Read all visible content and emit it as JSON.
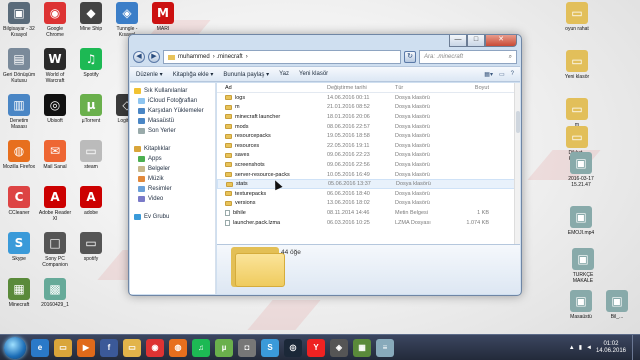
{
  "desktop": {
    "icons": [
      {
        "label": "Bilgisayar - 32 Kısayol",
        "color": "#5a6b7a",
        "glyph": "▣"
      },
      {
        "label": "Google Chrome",
        "color": "#d33",
        "glyph": "◉"
      },
      {
        "label": "Mine Ship",
        "color": "#444",
        "glyph": "◆"
      },
      {
        "label": "Tunngle - Kısayol",
        "color": "#3b7ec8",
        "glyph": "◈"
      },
      {
        "label": "MARI",
        "color": "#c11",
        "glyph": "M"
      },
      {
        "label": "Geri Dönüşüm Kutusu",
        "color": "#7a8a9a",
        "glyph": "▤"
      },
      {
        "label": "World of Warcraft",
        "color": "#2a2a2a",
        "glyph": "W"
      },
      {
        "label": "Spotify",
        "color": "#1db954",
        "glyph": "♫"
      },
      {
        "label": "Denetim Masası",
        "color": "#4a86c5",
        "glyph": "▥"
      },
      {
        "label": "Ubisoft",
        "color": "#111",
        "glyph": "◎"
      },
      {
        "label": "µTorrent",
        "color": "#6ab04c",
        "glyph": "µ"
      },
      {
        "label": "Logitech",
        "color": "#3a3a3a",
        "glyph": "◇"
      },
      {
        "label": "Mozilla Firefox",
        "color": "#e76f1e",
        "glyph": "◍"
      },
      {
        "label": "Mail Sanal",
        "color": "#e63",
        "glyph": "✉"
      },
      {
        "label": "steam",
        "color": "#bbb",
        "glyph": "▭"
      },
      {
        "label": "CCleaner",
        "color": "#d44",
        "glyph": "C"
      },
      {
        "label": "Adobe Reader XI",
        "color": "#c00",
        "glyph": "A"
      },
      {
        "label": "adobe",
        "color": "#c00",
        "glyph": "A"
      },
      {
        "label": "Skype",
        "color": "#3a9ad9",
        "glyph": "S"
      },
      {
        "label": "Sony PC Companion",
        "color": "#555",
        "glyph": "□"
      },
      {
        "label": "spotify",
        "color": "#555",
        "glyph": "▭"
      },
      {
        "label": "Minecraft",
        "color": "#5a8a3a",
        "glyph": "▦"
      },
      {
        "label": "20160429_1",
        "color": "#6a9",
        "glyph": "▩"
      }
    ],
    "right_icons": [
      "oyun rahat",
      "Yeni klasör",
      "m",
      "Dikkat - Kısayol",
      "2016-03-17 15.21.47",
      "EMOJI.mp4",
      "TÜRKÇE MAKALE",
      "Masaüstü",
      "Bil_..."
    ]
  },
  "window": {
    "address": {
      "parts": [
        "muhammed",
        "› .minecraft",
        "›"
      ],
      "search_placeholder": "Ara: .minecraft"
    },
    "controls": {
      "minimize": "—",
      "maximize": "□",
      "close": "✕"
    },
    "toolbar": {
      "items": [
        "Düzenle ▾",
        "Kitaplığa ekle ▾",
        "Bununla paylaş ▾",
        "Yaz",
        "Yeni klasör"
      ]
    },
    "nav": {
      "favorites_title": "Sık Kullanılanlar",
      "favorites": [
        "iCloud Fotoğrafları",
        "Karşıdan Yüklemeler",
        "Masaüstü",
        "Son Yerler"
      ],
      "libraries_title": "Kitaplıklar",
      "libraries": [
        "Apps",
        "Belgeler",
        "Müzik",
        "Resimler",
        "Video"
      ],
      "homegroup": "Ev Grubu"
    },
    "columns": [
      "Ad",
      "Değiştirme tarihi",
      "Tür",
      "Boyut"
    ],
    "files": [
      {
        "name": "logs",
        "date": "14.06.2016 00:11",
        "type": "Dosya klasörü",
        "size": "",
        "kind": "folder"
      },
      {
        "name": "m",
        "date": "21.01.2016 08:52",
        "type": "Dosya klasörü",
        "size": "",
        "kind": "folder"
      },
      {
        "name": "minecraft launcher",
        "date": "18.01.2016 20:06",
        "type": "Dosya klasörü",
        "size": "",
        "kind": "folder"
      },
      {
        "name": "mods",
        "date": "08.06.2016 22:57",
        "type": "Dosya klasörü",
        "size": "",
        "kind": "folder"
      },
      {
        "name": "resourcepacks",
        "date": "19.05.2016 18:58",
        "type": "Dosya klasörü",
        "size": "",
        "kind": "folder"
      },
      {
        "name": "resources",
        "date": "22.05.2016 19:11",
        "type": "Dosya klasörü",
        "size": "",
        "kind": "folder"
      },
      {
        "name": "saves",
        "date": "09.06.2016 22:23",
        "type": "Dosya klasörü",
        "size": "",
        "kind": "folder"
      },
      {
        "name": "screenshots",
        "date": "09.06.2016 22:56",
        "type": "Dosya klasörü",
        "size": "",
        "kind": "folder"
      },
      {
        "name": "server-resource-packs",
        "date": "10.05.2016 16:49",
        "type": "Dosya klasörü",
        "size": "",
        "kind": "folder"
      },
      {
        "name": "stats",
        "date": "05.06.2016 13:37",
        "type": "Dosya klasörü",
        "size": "",
        "kind": "folder",
        "selected": true
      },
      {
        "name": "texturepacks",
        "date": "06.06.2016 18:40",
        "type": "Dosya klasörü",
        "size": "",
        "kind": "folder"
      },
      {
        "name": "versions",
        "date": "13.06.2016 18:02",
        "type": "Dosya klasörü",
        "size": "",
        "kind": "folder"
      },
      {
        "name": "bihile",
        "date": "08.11.2014 14:46",
        "type": "Metin Belgesi",
        "size": "1 KB",
        "kind": "file"
      },
      {
        "name": "launcher.pack.lzma",
        "date": "06.03.2016 10:25",
        "type": "LZMA Dosyası",
        "size": "1.074 KB",
        "kind": "file"
      }
    ],
    "status": {
      "count": "44 öğe"
    }
  },
  "taskbar": {
    "apps": [
      {
        "name": "ie",
        "color": "#2a79c8",
        "glyph": "e"
      },
      {
        "name": "explorer",
        "color": "#d9a53a",
        "glyph": "▭"
      },
      {
        "name": "media",
        "color": "#e06a1a",
        "glyph": "▶"
      },
      {
        "name": "facebook",
        "color": "#3b5998",
        "glyph": "f"
      },
      {
        "name": "explorer2",
        "color": "#e2b44a",
        "glyph": "▭"
      },
      {
        "name": "chrome",
        "color": "#d33",
        "glyph": "◉"
      },
      {
        "name": "firefox",
        "color": "#e76f1e",
        "glyph": "◍"
      },
      {
        "name": "spotify",
        "color": "#1db954",
        "glyph": "♫"
      },
      {
        "name": "utorrent",
        "color": "#6ab04c",
        "glyph": "µ"
      },
      {
        "name": "camera",
        "color": "#777",
        "glyph": "◘"
      },
      {
        "name": "skype",
        "color": "#3a9ad9",
        "glyph": "S"
      },
      {
        "name": "steam",
        "color": "#1b2838",
        "glyph": "◎"
      },
      {
        "name": "yandex",
        "color": "#e22",
        "glyph": "Y"
      },
      {
        "name": "teamspeak",
        "color": "#555",
        "glyph": "◈"
      },
      {
        "name": "minecraft",
        "color": "#5a8a3a",
        "glyph": "▦"
      },
      {
        "name": "notepad",
        "color": "#8ab",
        "glyph": "≡"
      }
    ],
    "time": "01:02",
    "date": "14.06.2016"
  }
}
